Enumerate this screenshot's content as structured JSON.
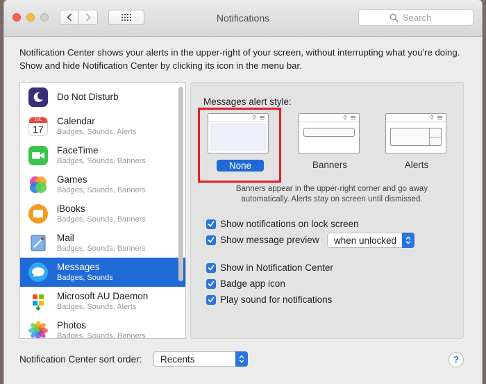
{
  "window": {
    "title": "Notifications",
    "search_placeholder": "Search"
  },
  "description": "Notification Center shows your alerts in the upper-right of your screen, without interrupting what you're doing. Show and hide Notification Center by clicking its icon in the menu bar.",
  "apps": [
    {
      "name": "Do Not Disturb",
      "sub": "",
      "icon": "moon-icon",
      "color": "#3b2d7a"
    },
    {
      "name": "Calendar",
      "sub": "Badges, Sounds, Alerts",
      "icon": "calendar-icon",
      "color": "#e8473b",
      "cal_month": "JUL",
      "cal_day": "17"
    },
    {
      "name": "FaceTime",
      "sub": "Badges, Sounds, Banners",
      "icon": "facetime-icon",
      "color": "#38c548"
    },
    {
      "name": "Games",
      "sub": "Badges, Sounds, Banners",
      "icon": "games-icon",
      "color": "#f04fa2"
    },
    {
      "name": "iBooks",
      "sub": "Badges, Sounds, Banners",
      "icon": "ibooks-icon",
      "color": "#f39a22"
    },
    {
      "name": "Mail",
      "sub": "Badges, Sounds, Banners",
      "icon": "mail-icon",
      "color": "#4f8fd6"
    },
    {
      "name": "Messages",
      "sub": "Badges, Sounds",
      "icon": "messages-icon",
      "color": "#2fa7f5",
      "selected": true
    },
    {
      "name": "Microsoft AU Daemon",
      "sub": "Badges, Sounds, Alerts",
      "icon": "microsoft-au-icon",
      "color": "#d9d9d9"
    },
    {
      "name": "Photos",
      "sub": "Badges, Sounds, Banners",
      "icon": "photos-icon",
      "color": "#f7f7f7"
    }
  ],
  "panel": {
    "alert_style_title": "Messages alert style:",
    "styles": {
      "none": "None",
      "banners": "Banners",
      "alerts": "Alerts"
    },
    "note": "Banners appear in the upper-right corner and go away automatically. Alerts stay on screen until dismissed.",
    "options": {
      "lock_screen": "Show notifications on lock screen",
      "preview": "Show message preview",
      "preview_value": "when unlocked",
      "notification_center": "Show in Notification Center",
      "badge": "Badge app icon",
      "sound": "Play sound for notifications"
    }
  },
  "footer": {
    "sort_label": "Notification Center sort order:",
    "sort_value": "Recents",
    "help": "?"
  },
  "colors": {
    "accent": "#2a74dd",
    "selection": "#1f6ad6",
    "highlight": "#e41e25"
  }
}
